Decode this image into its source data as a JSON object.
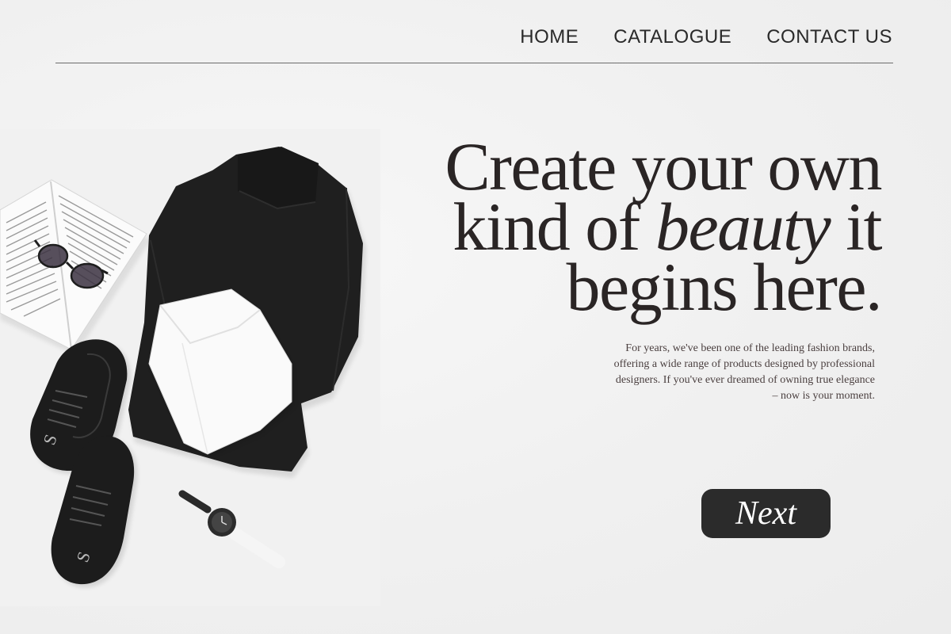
{
  "nav": {
    "items": [
      {
        "label": "HOME"
      },
      {
        "label": "CATALOGUE"
      },
      {
        "label": "CONTACT US"
      }
    ]
  },
  "hero": {
    "headline_line1": "Create your own",
    "headline_line2_a": "kind of ",
    "headline_line2_em": "beauty",
    "headline_line2_b": " it",
    "headline_line3": "begins here.",
    "description": "For years, we've been one of the leading fashion brands, offering a wide range of products designed by professional designers. If you've ever dreamed of owning true elegance – now is your moment.",
    "next_label": "Next"
  },
  "photo": {
    "items": [
      "open-book",
      "sunglasses",
      "black-turtleneck",
      "white-turtleneck",
      "black-sneakers",
      "wristwatch"
    ]
  },
  "colors": {
    "background": "#f2f2f2",
    "text": "#2a2525",
    "button": "#2b2b2b",
    "button_text": "#ffffff"
  }
}
